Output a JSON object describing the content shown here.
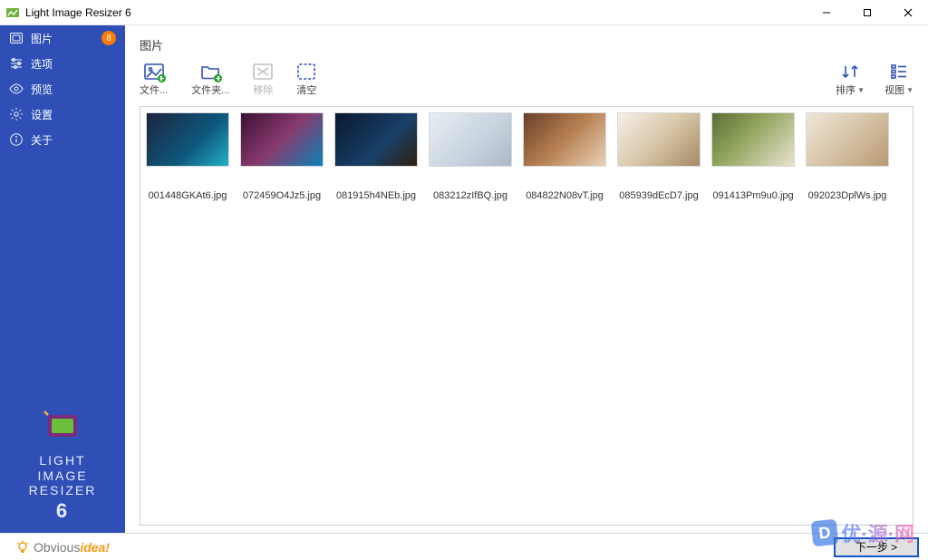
{
  "window": {
    "title": "Light Image Resizer 6"
  },
  "sidebar": {
    "items": [
      {
        "label": "图片",
        "badge": "8"
      },
      {
        "label": "选项"
      },
      {
        "label": "预览"
      },
      {
        "label": "设置"
      },
      {
        "label": "关于"
      }
    ],
    "brand_line1": "LIGHT",
    "brand_line2": "IMAGE",
    "brand_line3": "RESIZER",
    "brand_big": "6",
    "footer_prefix": "Obvious",
    "footer_suffix": "idea!"
  },
  "page": {
    "title": "图片"
  },
  "toolbar": {
    "files_label": "文件...",
    "folders_label": "文件夹...",
    "remove_label": "移除",
    "clear_label": "清空",
    "sort_label": "排序",
    "view_label": "视图"
  },
  "images": [
    {
      "filename": "001448GKAt6.jpg"
    },
    {
      "filename": "072459O4Jz5.jpg"
    },
    {
      "filename": "081915h4NEb.jpg"
    },
    {
      "filename": "083212zIfBQ.jpg"
    },
    {
      "filename": "084822N08vT.jpg"
    },
    {
      "filename": "085939dEcD7.jpg"
    },
    {
      "filename": "091413Pm9u0.jpg"
    },
    {
      "filename": "092023DplWs.jpg"
    }
  ],
  "actions": {
    "next": "下一步 >"
  },
  "watermark": {
    "text": "优·源·网"
  }
}
